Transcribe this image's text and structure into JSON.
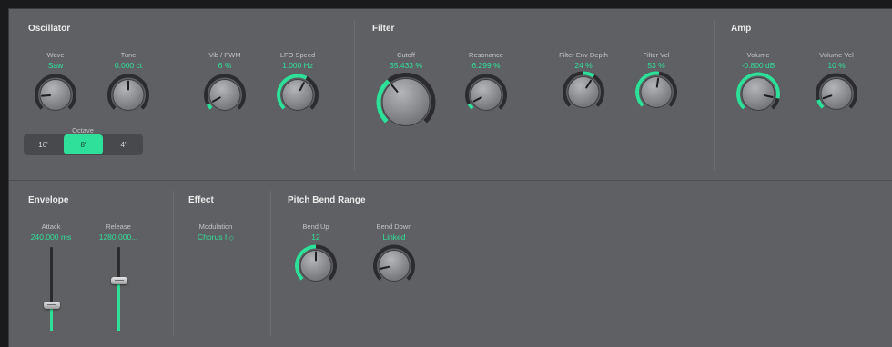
{
  "colors": {
    "accent": "#2fe09a",
    "panel": "#5f6063",
    "knob_ring": "#2c2c2e"
  },
  "oscillator": {
    "title": "Oscillator",
    "wave": {
      "label": "Wave",
      "value": "Saw",
      "level": 0.15
    },
    "tune": {
      "label": "Tune",
      "value": "0.000 ct",
      "level": 0.5
    },
    "vib_pwm": {
      "label": "Vib / PWM",
      "value": "6 %",
      "level": 0.06
    },
    "lfo_speed": {
      "label": "LFO Speed",
      "value": "1.000 Hz",
      "level": 0.6
    },
    "octave": {
      "label": "Octave",
      "options": [
        "16'",
        "8'",
        "4'"
      ],
      "selected": "8'"
    }
  },
  "filter": {
    "title": "Filter",
    "cutoff": {
      "label": "Cutoff",
      "value": "35.433 %",
      "level": 0.354
    },
    "resonance": {
      "label": "Resonance",
      "value": "6.299 %",
      "level": 0.063
    },
    "env_depth": {
      "label": "Filter Env Depth",
      "value": "24 %",
      "level": 0.62
    },
    "velocity": {
      "label": "Filter Vel",
      "value": "53 %",
      "level": 0.53
    }
  },
  "amp": {
    "title": "Amp",
    "volume": {
      "label": "Volume",
      "value": "-0.800 dB",
      "level": 0.88
    },
    "volume_vel": {
      "label": "Volume Vel",
      "value": "10 %",
      "level": 0.1
    }
  },
  "envelope": {
    "title": "Envelope",
    "attack": {
      "label": "Attack",
      "value": "240.000 ms",
      "level": 0.3
    },
    "release": {
      "label": "Release",
      "value": "1280.000...",
      "level": 0.6
    }
  },
  "effect": {
    "title": "Effect",
    "modulation": {
      "label": "Modulation",
      "value": "Chorus I"
    }
  },
  "pitch_bend": {
    "title": "Pitch Bend Range",
    "bend_up": {
      "label": "Bend Up",
      "value": "12",
      "level": 0.5
    },
    "bend_down": {
      "label": "Bend Down",
      "value": "Linked",
      "level": 0.12
    }
  }
}
